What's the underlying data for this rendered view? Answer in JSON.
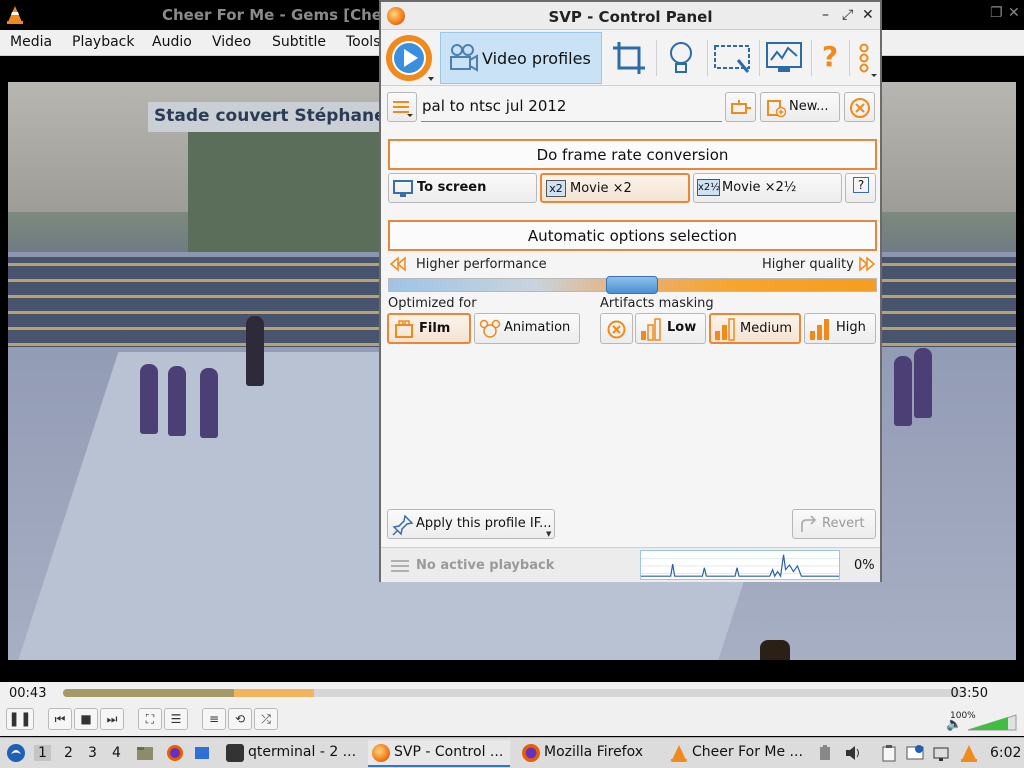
{
  "vlc": {
    "title": "Cheer For Me - Gems  [Che",
    "menu": [
      "Media",
      "Playback",
      "Audio",
      "Video",
      "Subtitle",
      "Tools"
    ],
    "video_banner_text": "Stade couvert Stéphane Dia",
    "time_elapsed": "00:43",
    "time_total": "03:50",
    "progress_fraction": 0.19,
    "buffer_fraction": 0.28,
    "volume_pct": "100%"
  },
  "svp": {
    "title": "SVP - Control Panel",
    "toolbar": {
      "active_tab_label": "Video profiles",
      "icons": [
        "crop-icon",
        "lightbulb-icon",
        "screen-region-icon",
        "monitor-icon",
        "help-icon",
        "more-icon"
      ],
      "help_glyph": "?"
    },
    "profile": {
      "name": "pal to ntsc jul 2012",
      "new_button": "New..."
    },
    "frame_rate": {
      "header": "Do frame rate conversion",
      "options": [
        {
          "badge": "",
          "label": "To screen",
          "selected": false
        },
        {
          "badge": "x2",
          "label": "Movie ×2",
          "selected": true
        },
        {
          "badge": "x2½",
          "label": "Movie ×2½",
          "selected": false
        }
      ],
      "help_glyph": "?"
    },
    "auto": {
      "header": "Automatic options selection",
      "left_label": "Higher performance",
      "right_label": "Higher quality",
      "slider_position": 0.5
    },
    "optimized": {
      "label": "Optimized for",
      "options": [
        {
          "label": "Film",
          "selected": true
        },
        {
          "label": "Animation",
          "selected": false
        }
      ]
    },
    "artifacts": {
      "label": "Artifacts masking",
      "options": [
        {
          "label": "Low",
          "selected": false
        },
        {
          "label": "Medium",
          "selected": true
        },
        {
          "label": "High",
          "selected": false
        }
      ]
    },
    "apply_button": "Apply this profile IF...",
    "revert_button": "Revert",
    "status": "No active playback",
    "load_pct": "0%"
  },
  "taskbar": {
    "workspaces": [
      "1",
      "2",
      "3",
      "4"
    ],
    "tasks": [
      {
        "label": "qterminal - 2 ...",
        "active": false
      },
      {
        "label": "SVP - Control ...",
        "active": true
      },
      {
        "label": "Mozilla Firefox",
        "active": false
      },
      {
        "label": "Cheer For Me ...",
        "active": false
      }
    ],
    "clock": "6:02"
  },
  "colors": {
    "accent_orange": "#e8863a",
    "tab_blue": "#c9e2f5",
    "vlc_orange": "#f2b55b"
  }
}
